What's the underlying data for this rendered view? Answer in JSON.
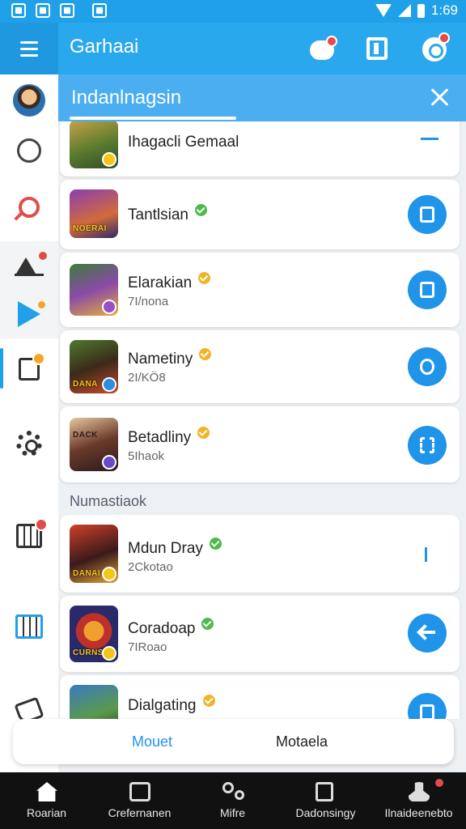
{
  "status_bar": {
    "time": "1:69"
  },
  "app_bar": {
    "title": "Garhaai"
  },
  "search": {
    "text": "Indanlnagsin"
  },
  "games": [
    {
      "name": "Ihagacli Gemaal",
      "subtitle": "",
      "verified_color": "",
      "action": "dash"
    },
    {
      "name": "Tantlsian",
      "subtitle": "",
      "verified_color": "#4cbb4c",
      "action": "button",
      "thumb_text": "NOERAI"
    },
    {
      "name": "Elarakian",
      "subtitle": "7I/nona",
      "verified_color": "#f0b429",
      "action": "button",
      "thumb_text": ""
    },
    {
      "name": "Nametiny",
      "subtitle": "2I/KÖ8",
      "verified_color": "#f0b429",
      "action": "button",
      "thumb_text": "DANA"
    },
    {
      "name": "Betadliny",
      "subtitle": "5Ihaok",
      "verified_color": "#f0b429",
      "action": "button",
      "thumb_text": "DACK"
    },
    {
      "name": "Mdun Dray",
      "subtitle": "2Ckotao",
      "verified_color": "#4cbb4c",
      "action": "bar",
      "thumb_text": "DANAI"
    },
    {
      "name": "Coradoap",
      "subtitle": "7IRoao",
      "verified_color": "#4cbb4c",
      "action": "arrow",
      "thumb_text": "CURNS"
    },
    {
      "name": "Dialgating",
      "subtitle": "",
      "verified_color": "#f0b429",
      "action": "button",
      "thumb_text": ""
    }
  ],
  "section_label": "Numastiaok",
  "tabs": {
    "first": "Mouet",
    "second": "Motaela"
  },
  "bottom_nav": [
    {
      "label": "Roarian",
      "icon": "home-icon"
    },
    {
      "label": "Crefernanen",
      "icon": "screen-icon"
    },
    {
      "label": "Mifre",
      "icon": "nodes-icon"
    },
    {
      "label": "Dadonsingy",
      "icon": "document-icon"
    },
    {
      "label": "Ilnaideenebto",
      "icon": "profile-icon"
    }
  ],
  "colors": {
    "accent": "#1f94e8",
    "appbar": "#2aa8ee",
    "search_bar": "#4aaef0"
  }
}
